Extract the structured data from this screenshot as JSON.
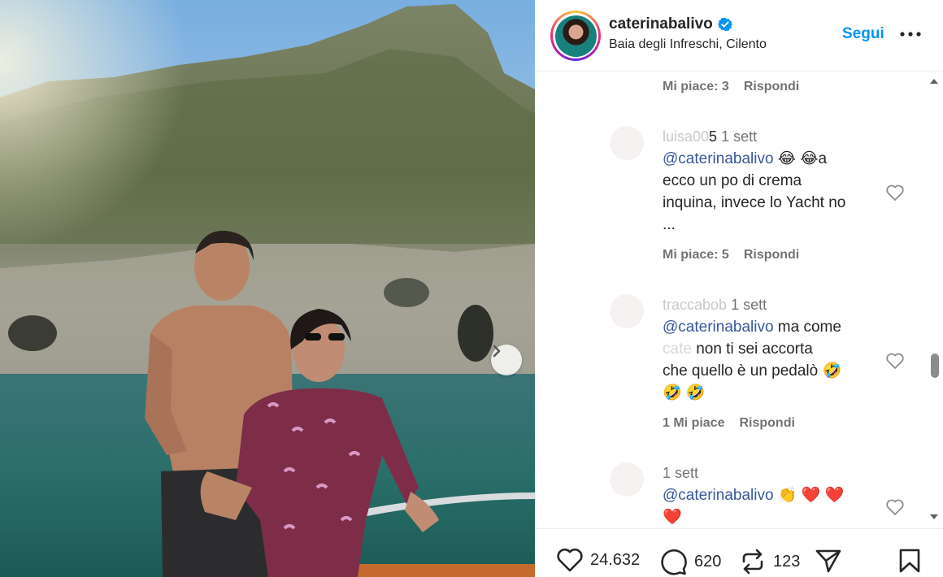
{
  "post": {
    "username": "caterinabalivo",
    "location": "Baia degli Infreschi, Cilento",
    "follow_label": "Segui"
  },
  "comments": [
    {
      "likes": "Mi piace: 3",
      "reply": "Rispondi"
    },
    {
      "user_visible": "5",
      "time": "1 sett",
      "mention": "@caterinabalivo",
      "text_after_mention": " 😂 😂a",
      "text_lines": [
        "ecco un po di crema",
        "inquina, invece lo Yacht no",
        "..."
      ],
      "likes": "Mi piace: 5",
      "reply": "Rispondi"
    },
    {
      "user_visible": "traccabob",
      "time": "1 sett",
      "mention": "@caterinabalivo",
      "text_after_mention": " ma come",
      "text_lines": [
        "non ti sei accorta",
        "che quello è un pedalò 🤣",
        "🤣 🤣"
      ],
      "likes": "1 Mi piace",
      "reply": "Rispondi"
    },
    {
      "user_visible": "",
      "time": "1 sett",
      "mention": "@caterinabalivo",
      "text_after_mention": " 👏 ❤️ ❤️",
      "text_lines": [
        "❤️"
      ]
    }
  ],
  "actions": {
    "likes": "24.632",
    "comments": "620",
    "reposts": "123"
  },
  "colors": {
    "follow": "#0095f6",
    "mention": "#385898",
    "meta": "#737373"
  }
}
